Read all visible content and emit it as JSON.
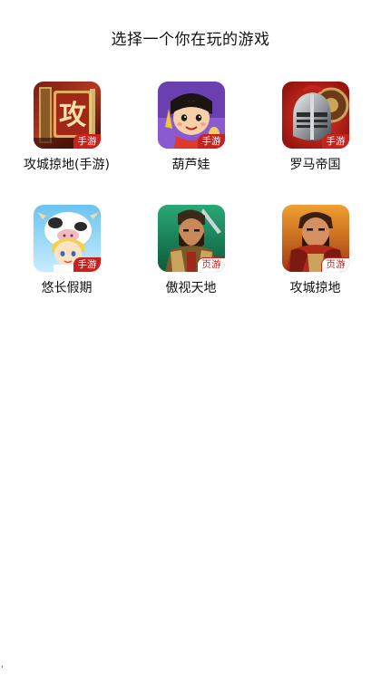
{
  "header": {
    "title": "选择一个你在玩的游戏"
  },
  "games": [
    {
      "name": "攻城掠地(手游)",
      "badge": "手游",
      "icon": "siege-mobile-icon"
    },
    {
      "name": "葫芦娃",
      "badge": "手游",
      "icon": "calabash-brothers-icon"
    },
    {
      "name": "罗马帝国",
      "badge": "手游",
      "icon": "roman-knight-helmet-icon"
    },
    {
      "name": "悠长假期",
      "badge": "手游",
      "icon": "cow-girl-icon"
    },
    {
      "name": "傲视天地",
      "badge": "页游",
      "icon": "warrior-general-icon"
    },
    {
      "name": "攻城掠地",
      "badge": "页游",
      "icon": "bearded-general-icon"
    }
  ],
  "footer": {
    "corner_mark": "'"
  },
  "colors": {
    "badge_red": "#c9211d",
    "text": "#111111",
    "background": "#ffffff"
  }
}
